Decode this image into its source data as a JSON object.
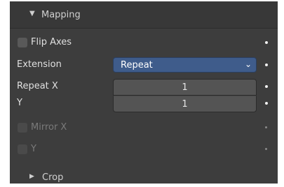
{
  "mapping": {
    "header_icon": "triangle-down-icon",
    "title": "Mapping",
    "flip_axes": {
      "label": "Flip Axes",
      "checked": false
    },
    "extension": {
      "label": "Extension",
      "value": "Repeat",
      "icon": "chevron-down-icon"
    },
    "repeat_x": {
      "label": "Repeat X",
      "value": "1"
    },
    "repeat_y": {
      "label": "Y",
      "value": "1"
    },
    "mirror_x": {
      "label": "Mirror X",
      "checked": false,
      "enabled": false
    },
    "mirror_y": {
      "label": "Y",
      "checked": false,
      "enabled": false
    },
    "crop": {
      "title": "Crop",
      "icon": "triangle-right-icon"
    }
  },
  "colors": {
    "panel_bg": "#3d3d3d",
    "header_bg": "#383838",
    "accent_dropdown": "#3f5c8b",
    "field_bg": "#545454"
  }
}
